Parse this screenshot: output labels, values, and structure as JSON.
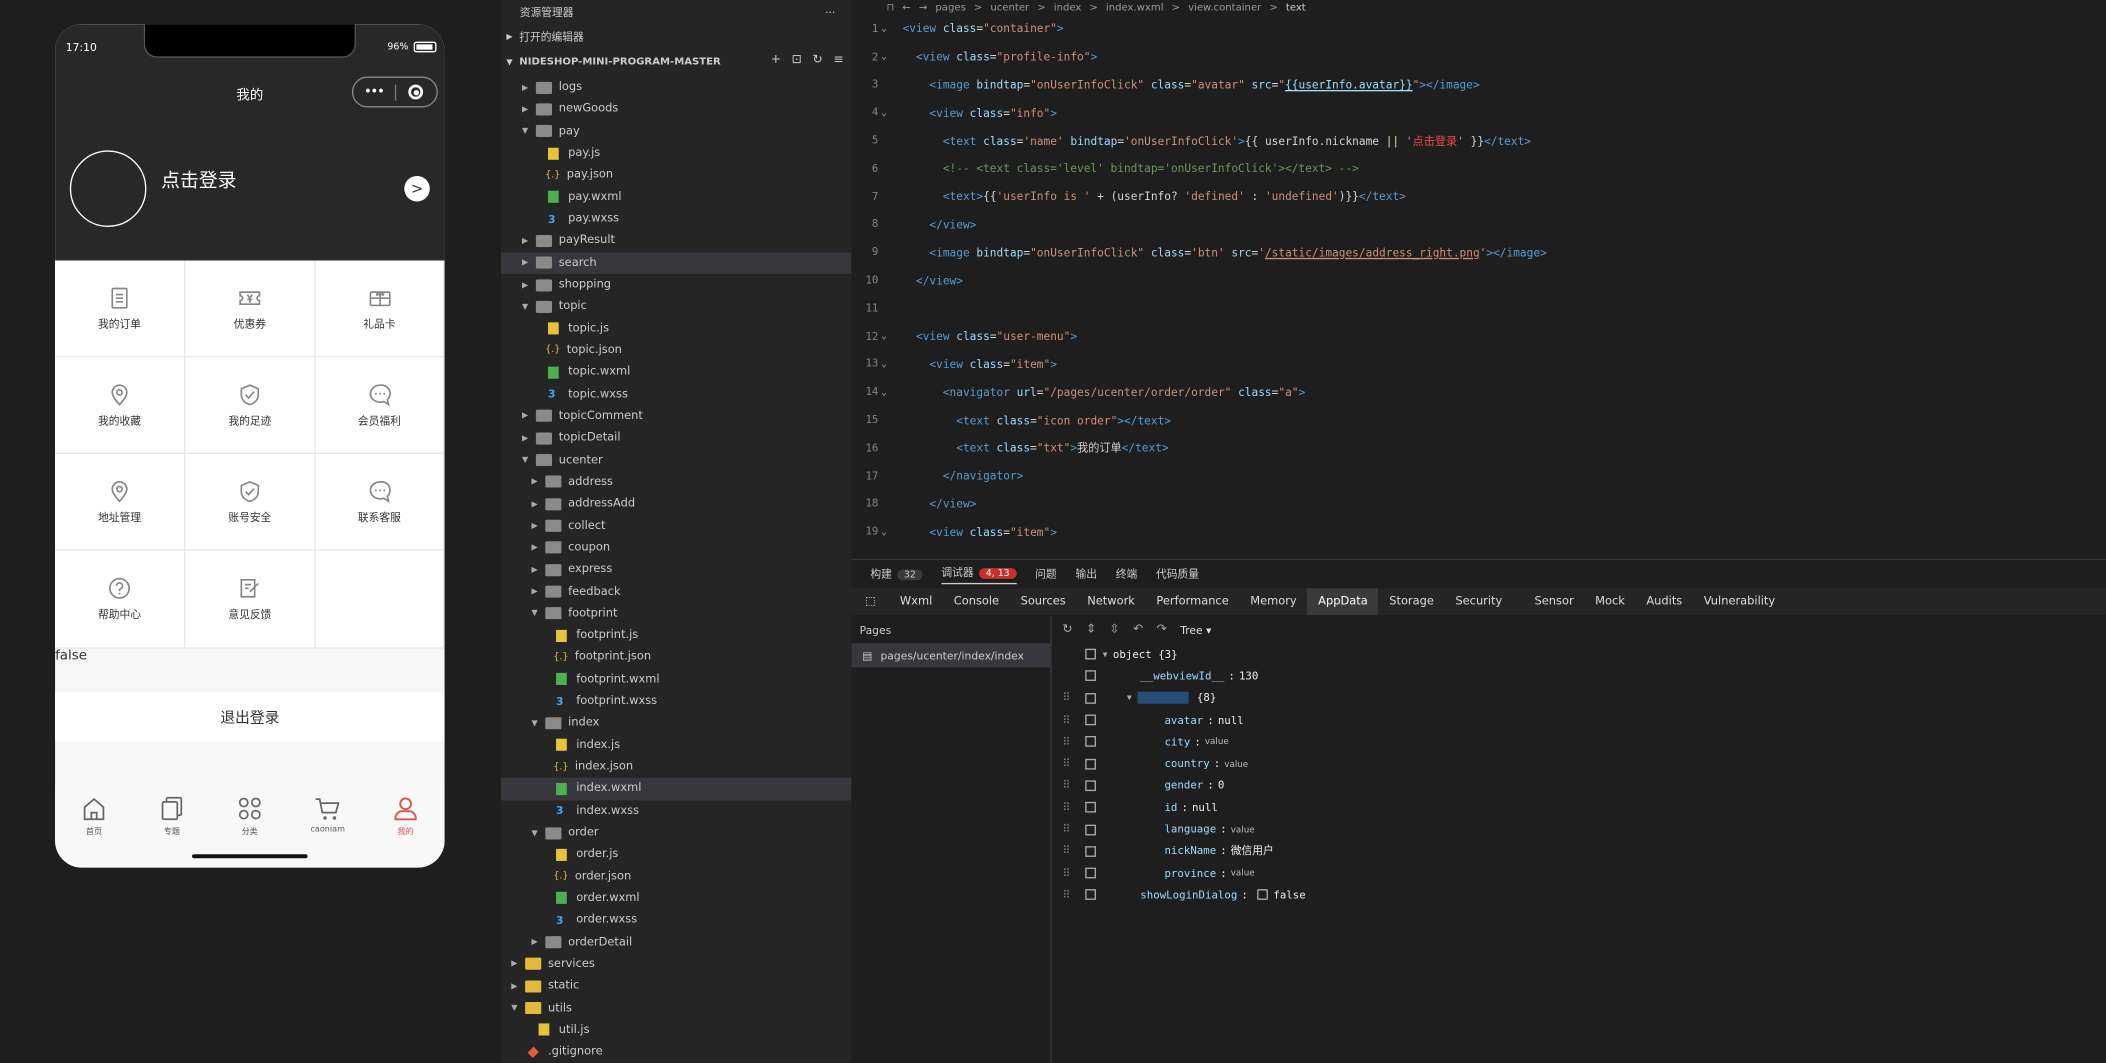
{
  "simulator": {
    "status_time": "17:10",
    "battery": "96%",
    "nav_title": "我的",
    "capsule_dots": "•••",
    "login_text": "点击登录",
    "arrow": ">",
    "grid": [
      {
        "label": "我的订单",
        "icon": "order-list-icon"
      },
      {
        "label": "优惠券",
        "icon": "coupon-icon"
      },
      {
        "label": "礼品卡",
        "icon": "gift-card-icon"
      },
      {
        "label": "我的收藏",
        "icon": "location-pin-icon"
      },
      {
        "label": "我的足迹",
        "icon": "shield-check-icon"
      },
      {
        "label": "会员福利",
        "icon": "chat-bubble-icon"
      },
      {
        "label": "地址管理",
        "icon": "location-pin-icon"
      },
      {
        "label": "账号安全",
        "icon": "shield-check-icon"
      },
      {
        "label": "联系客服",
        "icon": "chat-bubble-icon"
      },
      {
        "label": "帮助中心",
        "icon": "help-question-icon"
      },
      {
        "label": "意见反馈",
        "icon": "feedback-edit-icon"
      },
      {
        "label": "",
        "icon": ""
      }
    ],
    "debug_text": "false",
    "logout": "退出登录",
    "tabs": [
      {
        "label": "首页",
        "icon": "home-icon"
      },
      {
        "label": "专题",
        "icon": "topic-icon"
      },
      {
        "label": "分类",
        "icon": "category-icon"
      },
      {
        "label": "caoniam",
        "icon": "cart-icon"
      },
      {
        "label": "我的",
        "icon": "user-icon",
        "active": true
      }
    ]
  },
  "explorer": {
    "title": "资源管理器",
    "more": "···",
    "open_editors": "打开的编辑器",
    "project": "NIDESHOP-MINI-PROGRAM-MASTER",
    "tree": [
      {
        "name": "logs",
        "depth": 1,
        "type": "folder",
        "open": false
      },
      {
        "name": "newGoods",
        "depth": 1,
        "type": "folder",
        "open": false
      },
      {
        "name": "pay",
        "depth": 1,
        "type": "folder",
        "open": true
      },
      {
        "name": "pay.js",
        "depth": 2,
        "type": "js"
      },
      {
        "name": "pay.json",
        "depth": 2,
        "type": "json"
      },
      {
        "name": "pay.wxml",
        "depth": 2,
        "type": "wxml"
      },
      {
        "name": "pay.wxss",
        "depth": 2,
        "type": "wxss"
      },
      {
        "name": "payResult",
        "depth": 1,
        "type": "folder",
        "open": false
      },
      {
        "name": "search",
        "depth": 1,
        "type": "folder",
        "open": false,
        "selected": true
      },
      {
        "name": "shopping",
        "depth": 1,
        "type": "folder",
        "open": false
      },
      {
        "name": "topic",
        "depth": 1,
        "type": "folder",
        "open": true
      },
      {
        "name": "topic.js",
        "depth": 2,
        "type": "js"
      },
      {
        "name": "topic.json",
        "depth": 2,
        "type": "json"
      },
      {
        "name": "topic.wxml",
        "depth": 2,
        "type": "wxml"
      },
      {
        "name": "topic.wxss",
        "depth": 2,
        "type": "wxss"
      },
      {
        "name": "topicComment",
        "depth": 1,
        "type": "folder",
        "open": false
      },
      {
        "name": "topicDetail",
        "depth": 1,
        "type": "folder",
        "open": false
      },
      {
        "name": "ucenter",
        "depth": 1,
        "type": "folder",
        "open": true
      },
      {
        "name": "address",
        "depth": 2,
        "type": "folder",
        "open": false
      },
      {
        "name": "addressAdd",
        "depth": 2,
        "type": "folder",
        "open": false
      },
      {
        "name": "collect",
        "depth": 2,
        "type": "folder",
        "open": false
      },
      {
        "name": "coupon",
        "depth": 2,
        "type": "folder",
        "open": false
      },
      {
        "name": "express",
        "depth": 2,
        "type": "folder",
        "open": false
      },
      {
        "name": "feedback",
        "depth": 2,
        "type": "folder",
        "open": false
      },
      {
        "name": "footprint",
        "depth": 2,
        "type": "folder",
        "open": true
      },
      {
        "name": "footprint.js",
        "depth": 3,
        "type": "js"
      },
      {
        "name": "footprint.json",
        "depth": 3,
        "type": "json"
      },
      {
        "name": "footprint.wxml",
        "depth": 3,
        "type": "wxml"
      },
      {
        "name": "footprint.wxss",
        "depth": 3,
        "type": "wxss"
      },
      {
        "name": "index",
        "depth": 2,
        "type": "folder",
        "open": true
      },
      {
        "name": "index.js",
        "depth": 3,
        "type": "js"
      },
      {
        "name": "index.json",
        "depth": 3,
        "type": "json"
      },
      {
        "name": "index.wxml",
        "depth": 3,
        "type": "wxml",
        "selected": true
      },
      {
        "name": "index.wxss",
        "depth": 3,
        "type": "wxss"
      },
      {
        "name": "order",
        "depth": 2,
        "type": "folder",
        "open": true
      },
      {
        "name": "order.js",
        "depth": 3,
        "type": "js"
      },
      {
        "name": "order.json",
        "depth": 3,
        "type": "json"
      },
      {
        "name": "order.wxml",
        "depth": 3,
        "type": "wxml"
      },
      {
        "name": "order.wxss",
        "depth": 3,
        "type": "wxss"
      },
      {
        "name": "orderDetail",
        "depth": 2,
        "type": "folder",
        "open": false
      },
      {
        "name": "services",
        "depth": 0,
        "type": "fyel",
        "open": false
      },
      {
        "name": "static",
        "depth": 0,
        "type": "fyel",
        "open": false
      },
      {
        "name": "utils",
        "depth": 0,
        "type": "fyel",
        "open": true
      },
      {
        "name": "util.js",
        "depth": 1,
        "type": "js"
      },
      {
        "name": ".gitignore",
        "depth": 0,
        "type": "git"
      }
    ]
  },
  "editor": {
    "breadcrumb": [
      "pages",
      ">",
      "ucenter",
      ">",
      "index",
      ">",
      "index.wxml",
      ">",
      "view.container",
      ">",
      "text"
    ],
    "lines": [
      {
        "n": "1",
        "fold": "⌄",
        "html": "<span class='tg'>&lt;view</span> <span class='at'>class</span><span class='tx'>=</span><span class='st'>\"container\"</span><span class='tg'>&gt;</span>"
      },
      {
        "n": "2",
        "fold": "⌄",
        "html": "  <span class='tg'>&lt;view</span> <span class='at'>class</span><span class='tx'>=</span><span class='st'>\"profile-info\"</span><span class='tg'>&gt;</span>"
      },
      {
        "n": "3",
        "fold": "",
        "html": "    <span class='tg'>&lt;image</span> <span class='at'>bindtap</span><span class='tx'>=</span><span class='st'>\"onUserInfoClick\"</span> <span class='at'>class</span><span class='tx'>=</span><span class='st'>\"avatar\"</span> <span class='at'>src</span><span class='tx'>=</span><span class='st'>\"</span><span class='at ul'>{{userInfo.avatar}}</span><span class='st'>\"</span><span class='tg'>&gt;&lt;/image&gt;</span>"
      },
      {
        "n": "4",
        "fold": "⌄",
        "html": "    <span class='tg'>&lt;view</span> <span class='at'>class</span><span class='tx'>=</span><span class='st'>\"info\"</span><span class='tg'>&gt;</span>"
      },
      {
        "n": "5",
        "fold": "",
        "html": "      <span class='tg'>&lt;text</span> <span class='at'>class</span><span class='tx'>=</span><span class='st'>'name'</span> <span class='at'>bindtap</span><span class='tx'>=</span><span class='st'>'onUserInfoClick'</span><span class='tg'>&gt;</span><span class='tx'>{{ userInfo.nickname </span><span class='yl'>||</span> <span class='st'>'</span><span class='rd'>点击登录</span><span class='st'>'</span><span class='tx'> }}</span><span class='tg'>&lt;/text&gt;</span>"
      },
      {
        "n": "6",
        "fold": "",
        "html": "      <span class='cm'>&lt;!-- &lt;text class='level' bindtap='onUserInfoClick'&gt;&lt;/text&gt; --&gt;</span>"
      },
      {
        "n": "7",
        "fold": "",
        "html": "      <span class='tg'>&lt;text&gt;</span><span class='tx'>{{</span><span class='st'>'userInfo is '</span><span class='tx'> + (userInfo? </span><span class='st'>'defined'</span><span class='tx'> : </span><span class='st'>'undefined'</span><span class='tx'>)}}</span><span class='tg'>&lt;/text&gt;</span>"
      },
      {
        "n": "8",
        "fold": "",
        "html": "    <span class='tg'>&lt;/view&gt;</span>"
      },
      {
        "n": "9",
        "fold": "",
        "html": "    <span class='tg'>&lt;image</span> <span class='at'>bindtap</span><span class='tx'>=</span><span class='st'>\"onUserInfoClick\"</span> <span class='at'>class</span><span class='tx'>=</span><span class='st'>'btn'</span> <span class='at'>src</span><span class='tx'>=</span><span class='st'>'</span><span class='st ul'>/static/images/address_right.png</span><span class='st'>'</span><span class='tg'>&gt;&lt;/image&gt;</span>"
      },
      {
        "n": "10",
        "fold": "",
        "html": "  <span class='tg'>&lt;/view&gt;</span>"
      },
      {
        "n": "11",
        "fold": "",
        "html": ""
      },
      {
        "n": "12",
        "fold": "⌄",
        "html": "  <span class='tg'>&lt;view</span> <span class='at'>class</span><span class='tx'>=</span><span class='st'>\"user-menu\"</span><span class='tg'>&gt;</span>"
      },
      {
        "n": "13",
        "fold": "⌄",
        "html": "    <span class='tg'>&lt;view</span> <span class='at'>class</span><span class='tx'>=</span><span class='st'>\"item\"</span><span class='tg'>&gt;</span>"
      },
      {
        "n": "14",
        "fold": "⌄",
        "html": "      <span class='tg'>&lt;navigator</span> <span class='at'>url</span><span class='tx'>=</span><span class='st'>\"/pages/ucenter/order/order\"</span> <span class='at'>class</span><span class='tx'>=</span><span class='st'>\"a\"</span><span class='tg'>&gt;</span>"
      },
      {
        "n": "15",
        "fold": "",
        "html": "        <span class='tg'>&lt;text</span> <span class='at'>class</span><span class='tx'>=</span><span class='st'>\"icon order\"</span><span class='tg'>&gt;&lt;/text&gt;</span>"
      },
      {
        "n": "16",
        "fold": "",
        "html": "        <span class='tg'>&lt;text</span> <span class='at'>class</span><span class='tx'>=</span><span class='st'>\"txt\"</span><span class='tg'>&gt;</span><span class='tx'>我的订单</span><span class='tg'>&lt;/text&gt;</span>"
      },
      {
        "n": "17",
        "fold": "",
        "html": "      <span class='tg'>&lt;/navigator&gt;</span>"
      },
      {
        "n": "18",
        "fold": "",
        "html": "    <span class='tg'>&lt;/view&gt;</span>"
      },
      {
        "n": "19",
        "fold": "⌄",
        "html": "    <span class='tg'>&lt;view</span> <span class='at'>class</span><span class='tx'>=</span><span class='st'>\"item\"</span><span class='tg'>&gt;</span>"
      }
    ]
  },
  "devtools": {
    "top_tabs": [
      {
        "label": "构建",
        "badge": "32",
        "badge_color": "gray"
      },
      {
        "label": "调试器",
        "badge": "4, 13",
        "badge_color": "red",
        "active": true
      },
      {
        "label": "问题"
      },
      {
        "label": "输出"
      },
      {
        "label": "终端"
      },
      {
        "label": "代码质量"
      }
    ],
    "panel_tabs": [
      "Wxml",
      "Console",
      "Sources",
      "Network",
      "Performance",
      "Memory",
      "AppData",
      "Storage",
      "Security",
      "Sensor",
      "Mock",
      "Audits",
      "Vulnerability"
    ],
    "active_panel": "AppData",
    "pages_title": "Pages",
    "pages_item": "pages/ucenter/index/index",
    "view_mode": "Tree",
    "tree": [
      {
        "indent": 0,
        "caret": "▼",
        "key": "object {3}",
        "sep": "",
        "val": "",
        "kind": "root"
      },
      {
        "indent": 1,
        "caret": "",
        "key": "__webviewId__",
        "sep": ":",
        "val": "130",
        "kind": "num"
      },
      {
        "indent": 1,
        "caret": "▼",
        "key": "userInfo",
        "sep": "",
        "val": "{8}",
        "kind": "hl"
      },
      {
        "indent": 2,
        "caret": "",
        "key": "avatar",
        "sep": ":",
        "val": "null",
        "kind": "num"
      },
      {
        "indent": 2,
        "caret": "",
        "key": "city",
        "sep": ":",
        "val": "value",
        "kind": "small"
      },
      {
        "indent": 2,
        "caret": "",
        "key": "country",
        "sep": ":",
        "val": "value",
        "kind": "small"
      },
      {
        "indent": 2,
        "caret": "",
        "key": "gender",
        "sep": ":",
        "val": "0",
        "kind": "num"
      },
      {
        "indent": 2,
        "caret": "",
        "key": "id",
        "sep": ":",
        "val": "null",
        "kind": "num"
      },
      {
        "indent": 2,
        "caret": "",
        "key": "language",
        "sep": ":",
        "val": "value",
        "kind": "small"
      },
      {
        "indent": 2,
        "caret": "",
        "key": "nickName",
        "sep": ":",
        "val": "微信用户",
        "kind": "num"
      },
      {
        "indent": 2,
        "caret": "",
        "key": "province",
        "sep": ":",
        "val": "value",
        "kind": "small"
      },
      {
        "indent": 1,
        "caret": "",
        "key": "showLoginDialog",
        "sep": ":",
        "val": "false",
        "kind": "bool"
      }
    ]
  }
}
